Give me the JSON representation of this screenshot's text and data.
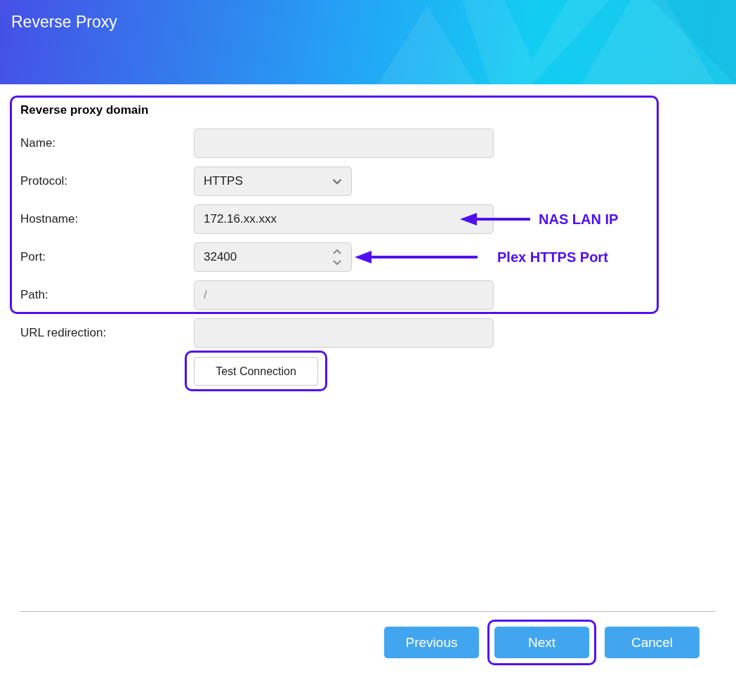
{
  "window": {
    "title": "Reverse Proxy"
  },
  "section": {
    "title": "Reverse proxy domain",
    "highlighted": true,
    "fields": [
      {
        "label": "Name:",
        "kind": "text"
      },
      {
        "label": "Protocol:",
        "kind": "select",
        "value": "HTTPS"
      },
      {
        "label": "Hostname:",
        "kind": "text",
        "value": "172.16.xx.xxx",
        "annotation": "NAS LAN IP"
      },
      {
        "label": "Port:",
        "kind": "number",
        "value": "32400",
        "annotation": "Plex HTTPS Port"
      },
      {
        "label": "Path:",
        "kind": "text",
        "placeholder": "/"
      }
    ]
  },
  "extra_fields": [
    {
      "label": "URL redirection:",
      "kind": "text"
    }
  ],
  "test_button": {
    "label": "Test Connection",
    "highlighted": true
  },
  "buttons": [
    {
      "label": "Previous",
      "highlighted": false
    },
    {
      "label": "Next",
      "highlighted": true
    },
    {
      "label": "Cancel",
      "highlighted": false
    }
  ]
}
